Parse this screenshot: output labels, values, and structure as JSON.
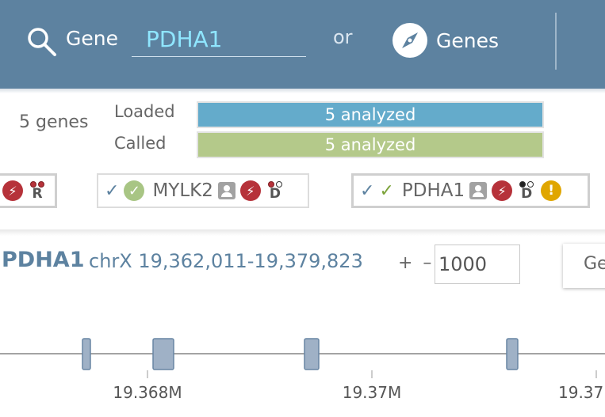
{
  "header": {
    "gene_label": "Gene",
    "gene_value": "PDHA1",
    "or_label": "or",
    "genes_label": "Genes"
  },
  "summary": {
    "genes_count": "5 genes",
    "loaded_label": "Loaded",
    "called_label": "Called",
    "loaded_bar": "5 analyzed",
    "called_bar": "5 analyzed"
  },
  "chips": {
    "partial": {
      "letter": "R"
    },
    "mylk2": {
      "name": "MYLK2",
      "letter": "D"
    },
    "pdha1": {
      "name": "PDHA1",
      "letter": "D"
    }
  },
  "region": {
    "gene_name": "PDHA1",
    "coords": "chrX 19,362,011-19,379,823",
    "plus_minus": "+ –",
    "flank_value": "1000",
    "go_label": "Ge"
  },
  "track": {
    "ticks": [
      "19.368M",
      "19.37M",
      "19.37"
    ]
  },
  "colors": {
    "header": "#5d82a0",
    "loaded": "#64abcb",
    "called": "#b4c98a",
    "high_impact": "#b6323a",
    "warning": "#e0a600"
  }
}
